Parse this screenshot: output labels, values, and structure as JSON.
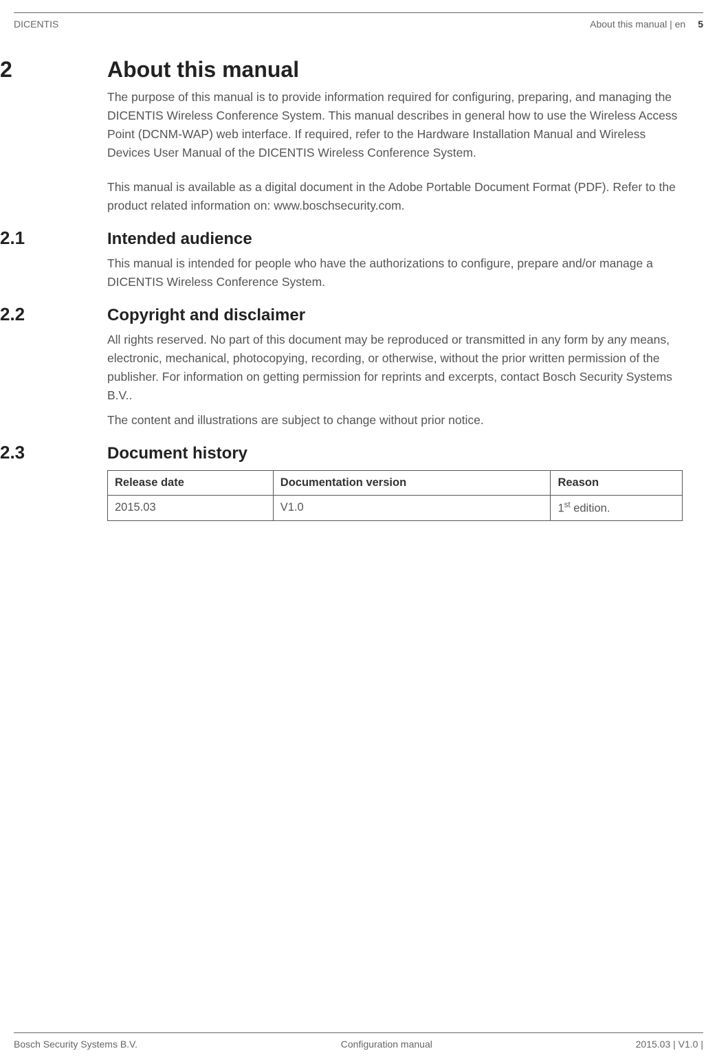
{
  "header": {
    "left": "DICENTIS",
    "right_text": "About this manual | en",
    "page_number": "5"
  },
  "sections": [
    {
      "number": "2",
      "title": "About this manual",
      "paragraphs": [
        "The purpose of this manual is to provide information required for configuring, preparing, and managing the DICENTIS Wireless Conference System. This manual describes in general how to use the Wireless Access Point (DCNM-WAP) web interface. If required, refer to the Hardware Installation Manual and Wireless Devices User Manual of the DICENTIS Wireless Conference System.",
        "This manual is available as a digital document in the Adobe Portable Document Format (PDF). Refer to the product related information on: www.boschsecurity.com."
      ]
    },
    {
      "number": "2.1",
      "title": "Intended audience",
      "paragraphs": [
        "This manual is intended for people who have the authorizations to configure, prepare and/or manage a DICENTIS Wireless Conference System."
      ]
    },
    {
      "number": "2.2",
      "title": "Copyright and disclaimer",
      "paragraphs": [
        "All rights reserved. No part of this document may be reproduced or transmitted in any form by any means, electronic, mechanical, photocopying, recording, or otherwise, without the prior written permission of the publisher. For information on getting permission for reprints and excerpts, contact Bosch Security Systems B.V..",
        "The content and illustrations are subject to change without prior notice."
      ]
    },
    {
      "number": "2.3",
      "title": "Document history",
      "paragraphs": []
    }
  ],
  "history_table": {
    "headers": [
      "Release date",
      "Documentation version",
      "Reason"
    ],
    "rows": [
      {
        "date": "2015.03",
        "version": "V1.0",
        "reason_prefix": "1",
        "reason_sup": "st",
        "reason_suffix": " edition."
      }
    ]
  },
  "footer": {
    "left": "Bosch Security Systems B.V.",
    "center": "Configuration manual",
    "right": "2015.03 | V1.0 |"
  }
}
